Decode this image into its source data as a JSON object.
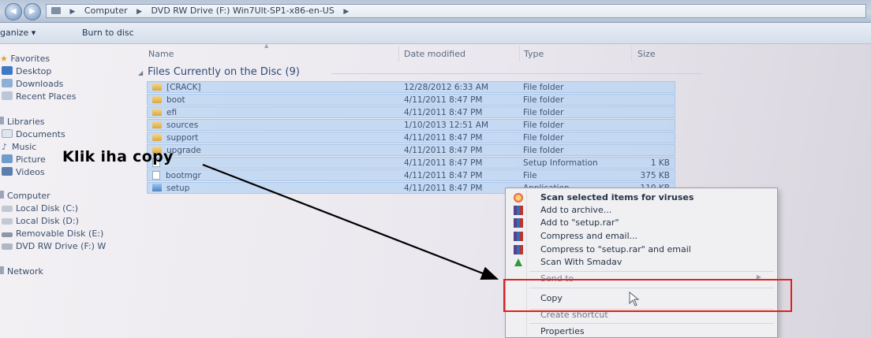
{
  "address": {
    "crumbs": [
      "Computer",
      "DVD RW Drive (F:) Win7Ult-SP1-x86-en-US"
    ]
  },
  "toolbar": {
    "organize_label": "ganize ▾",
    "burn_label": "Burn to disc"
  },
  "nav": {
    "favorites": "Favorites",
    "desktop": "Desktop",
    "downloads": "Downloads",
    "recent": "Recent Places",
    "libraries": "Libraries",
    "documents": "Documents",
    "music": "Music",
    "pictures": "Picture",
    "videos": "Videos",
    "computer": "Computer",
    "disk_c": "Local Disk (C:)",
    "disk_d": "Local Disk (D:)",
    "disk_e": "Removable Disk (E:)",
    "dvd": "DVD RW Drive (F:) W",
    "network": "Network"
  },
  "columns": {
    "name": "Name",
    "date": "Date modified",
    "type": "Type",
    "size": "Size"
  },
  "group_header": "Files Currently on the Disc (9)",
  "files": [
    {
      "name": "[CRACK]",
      "date": "12/28/2012 6:33 AM",
      "type": "File folder",
      "size": ""
    },
    {
      "name": "boot",
      "date": "4/11/2011 8:47 PM",
      "type": "File folder",
      "size": ""
    },
    {
      "name": "efi",
      "date": "4/11/2011 8:47 PM",
      "type": "File folder",
      "size": ""
    },
    {
      "name": "sources",
      "date": "1/10/2013 12:51 AM",
      "type": "File folder",
      "size": ""
    },
    {
      "name": "support",
      "date": "4/11/2011 8:47 PM",
      "type": "File folder",
      "size": ""
    },
    {
      "name": "upgrade",
      "date": "4/11/2011 8:47 PM",
      "type": "File folder",
      "size": ""
    },
    {
      "name": "",
      "date": "4/11/2011 8:47 PM",
      "type": "Setup Information",
      "size": "1 KB"
    },
    {
      "name": "bootmgr",
      "date": "4/11/2011 8:47 PM",
      "type": "File",
      "size": "375 KB"
    },
    {
      "name": "setup",
      "date": "4/11/2011 8:47 PM",
      "type": "Application",
      "size": "110 KB"
    }
  ],
  "context_menu": {
    "scan_viruses": "Scan selected items for viruses",
    "add_archive": "Add to archive...",
    "add_setup_rar": "Add to \"setup.rar\"",
    "compress_email": "Compress and email...",
    "compress_rar_email": "Compress to \"setup.rar\" and email",
    "scan_smadav": "Scan With Smadav",
    "send_to": "Send to",
    "copy": "Copy",
    "create_shortcut": "Create shortcut",
    "properties": "Properties"
  },
  "annotation": {
    "text": "Klik iha copy"
  },
  "colors": {
    "highlight_box": "#e02020",
    "selection": "#bed6f2",
    "arrow": "#000000"
  }
}
